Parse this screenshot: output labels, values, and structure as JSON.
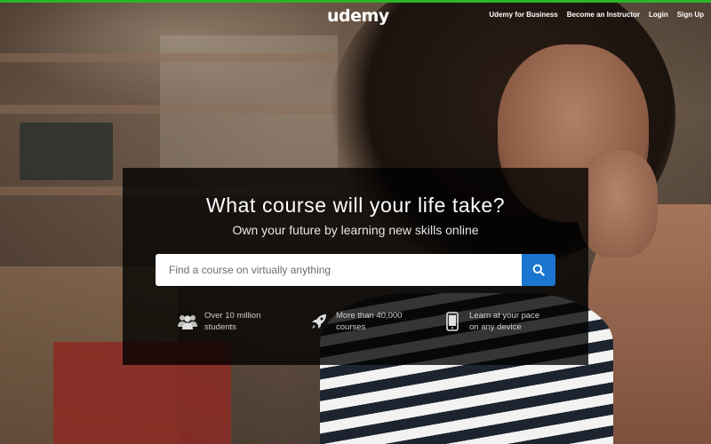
{
  "header": {
    "logo": "udemy",
    "nav": [
      "Udemy for Business",
      "Become an Instructor",
      "Login",
      "Sign Up"
    ]
  },
  "hero": {
    "title": "What course will your life take?",
    "subtitle": "Own your future by learning new skills online",
    "search": {
      "placeholder": "Find a course on virtually anything",
      "value": ""
    },
    "features": [
      {
        "icon": "group-icon",
        "line1": "Over 10 million",
        "line2": "students"
      },
      {
        "icon": "rocket-icon",
        "line1": "More than 40,000",
        "line2": "courses"
      },
      {
        "icon": "mobile-device-icon",
        "line1": "Learn at your pace",
        "line2": "on any device"
      }
    ]
  },
  "colors": {
    "accent_bar": "#2bb427",
    "search_button": "#1a76d1",
    "panel": "rgba(0,0,0,0.78)"
  }
}
